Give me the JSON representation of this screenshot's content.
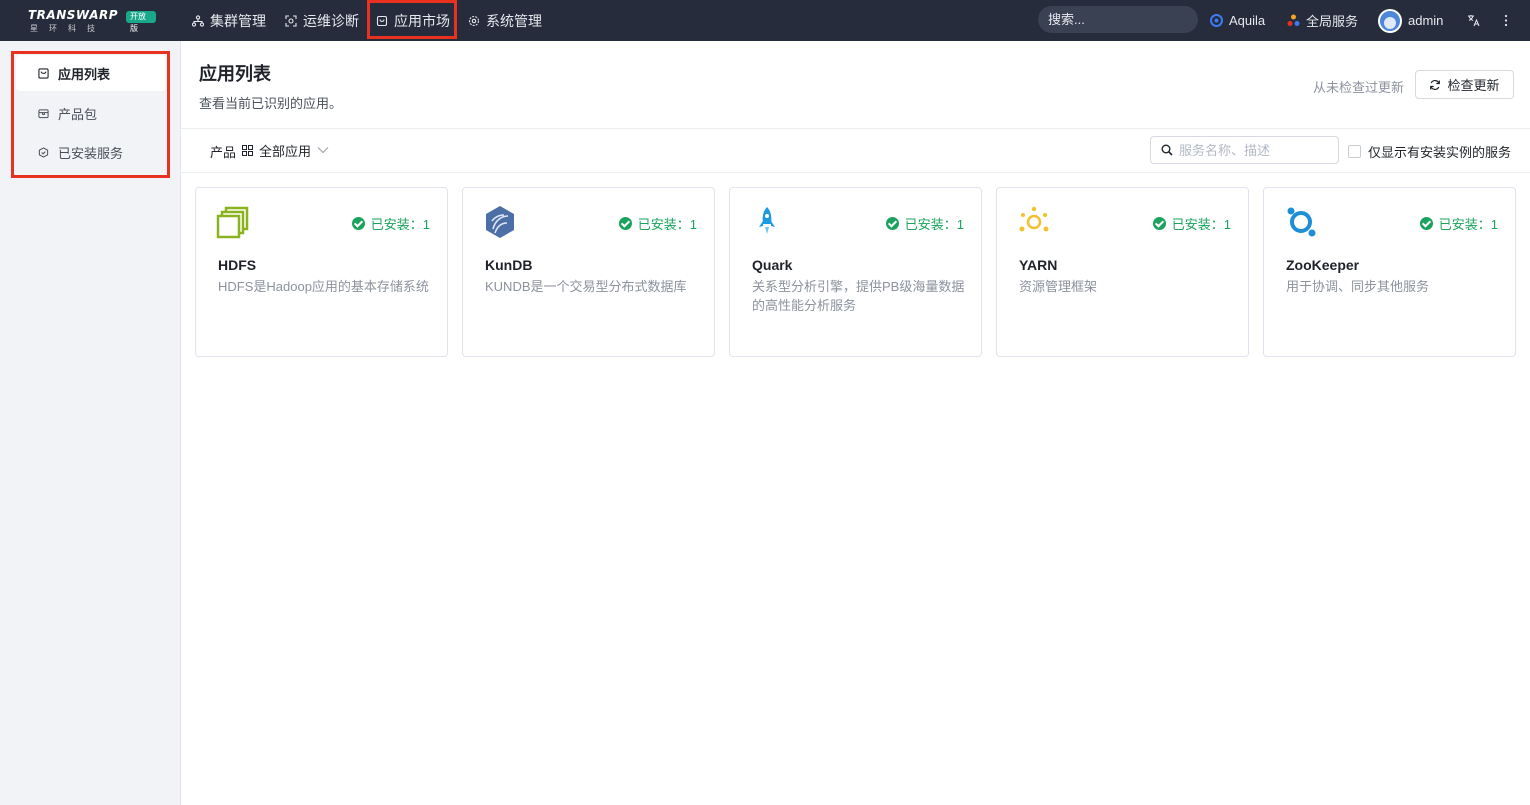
{
  "header": {
    "logo_text": "TRANSWARP",
    "logo_sub": "星环科技",
    "logo_badge": "开放版",
    "nav": [
      {
        "label": "集群管理",
        "icon": "cluster-icon"
      },
      {
        "label": "运维诊断",
        "icon": "diagnose-icon"
      },
      {
        "label": "应用市场",
        "icon": "market-icon"
      },
      {
        "label": "系统管理",
        "icon": "settings-icon"
      }
    ],
    "search_placeholder": "搜索...",
    "aquila": "Aquila",
    "global_services": "全局服务",
    "user": "admin",
    "colors": {
      "bg": "#262c3b",
      "highlight": "#e8321f"
    }
  },
  "sidebar": {
    "items": [
      {
        "label": "应用列表",
        "icon": "app-list-icon",
        "active": true
      },
      {
        "label": "产品包",
        "icon": "package-icon",
        "active": false
      },
      {
        "label": "已安装服务",
        "icon": "installed-services-icon",
        "active": false
      }
    ]
  },
  "main": {
    "title": "应用列表",
    "subtitle": "查看当前已识别的应用。",
    "never_checked": "从未检查过更新",
    "check_update": "检查更新",
    "filter_label": "产品",
    "filter_value": "全部应用",
    "search_placeholder": "服务名称、描述",
    "only_installed_label": "仅显示有安装实例的服务",
    "cards": [
      {
        "name": "HDFS",
        "status": "已安装：1",
        "desc": "HDFS是Hadoop应用的基本存储系统",
        "icon": "hdfs-logo-icon"
      },
      {
        "name": "KunDB",
        "status": "已安装：1",
        "desc": "KUNDB是一个交易型分布式数据库",
        "icon": "kundb-logo-icon"
      },
      {
        "name": "Quark",
        "status": "已安装：1",
        "desc": "关系型分析引擎，提供PB级海量数据的高性能分析服务",
        "icon": "quark-rocket-icon"
      },
      {
        "name": "YARN",
        "status": "已安装：1",
        "desc": "资源管理框架",
        "icon": "yarn-logo-icon"
      },
      {
        "name": "ZooKeeper",
        "status": "已安装：1",
        "desc": "用于协调、同步其他服务",
        "icon": "zookeeper-logo-icon"
      }
    ],
    "status_color": "#1aa35c"
  }
}
